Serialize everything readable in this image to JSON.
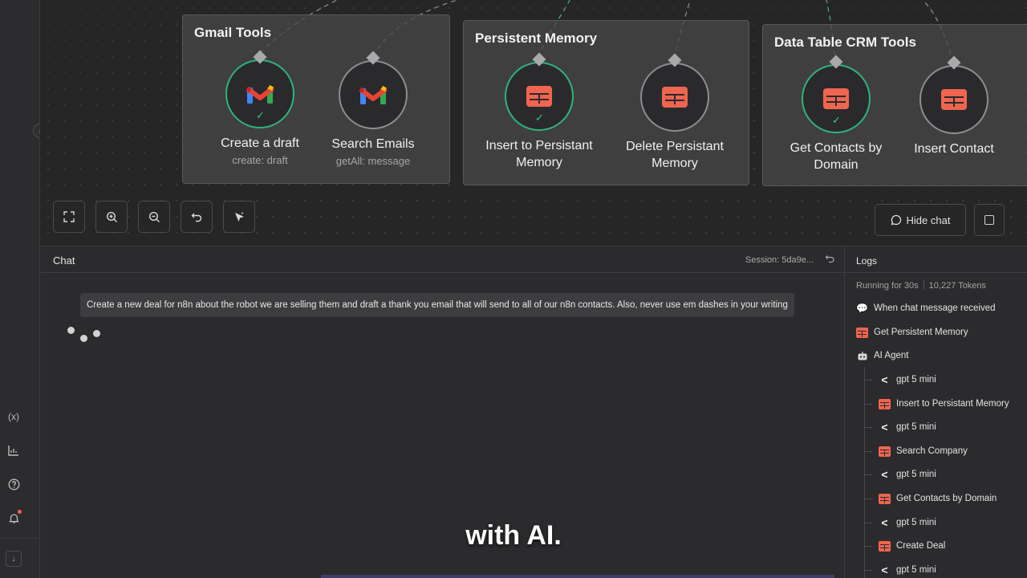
{
  "canvas": {
    "groups": [
      {
        "title": "Gmail Tools",
        "nodes": [
          {
            "title": "Create a draft",
            "subtitle": "create: draft",
            "icon": "gmail-icon",
            "status": "success"
          },
          {
            "title": "Search Emails",
            "subtitle": "getAll: message",
            "icon": "gmail-icon",
            "status": "idle"
          }
        ]
      },
      {
        "title": "Persistent Memory",
        "nodes": [
          {
            "title": "Insert to Persistant Memory",
            "subtitle": "",
            "icon": "data-table-icon",
            "status": "success"
          },
          {
            "title": "Delete Persistant Memory",
            "subtitle": "",
            "icon": "data-table-icon",
            "status": "idle"
          }
        ]
      },
      {
        "title": "Data Table CRM Tools",
        "nodes": [
          {
            "title": "Get Contacts by Domain",
            "subtitle": "",
            "icon": "data-table-icon",
            "status": "success"
          },
          {
            "title": "Insert Contact",
            "subtitle": "",
            "icon": "data-table-icon",
            "status": "idle"
          }
        ]
      }
    ],
    "toolbar": [
      "fit-view-icon",
      "zoom-in-icon",
      "zoom-out-icon",
      "undo-icon",
      "tidy-up-icon"
    ],
    "hide_chat_label": "Hide chat"
  },
  "chat": {
    "title": "Chat",
    "session": "Session: 5da9e...",
    "user_message": "Create a new deal for n8n about the robot we are selling them and draft a thank you email that will send to all of our n8n contacts. Also, never use em dashes in your writing"
  },
  "logs": {
    "title": "Logs",
    "running": "Running for 30s",
    "tokens": "10,227 Tokens",
    "items": [
      {
        "label": "When chat message received",
        "icon": "chat-icon",
        "level": 0
      },
      {
        "label": "Get Persistent Memory",
        "icon": "data-table-icon",
        "level": 0
      },
      {
        "label": "AI Agent",
        "icon": "robot-icon",
        "level": 0
      },
      {
        "label": "gpt 5 mini",
        "icon": "openai-icon",
        "level": 1
      },
      {
        "label": "Insert to Persistant Memory",
        "icon": "data-table-icon",
        "level": 1
      },
      {
        "label": "gpt 5 mini",
        "icon": "openai-icon",
        "level": 1
      },
      {
        "label": "Search Company",
        "icon": "data-table-icon",
        "level": 1
      },
      {
        "label": "gpt 5 mini",
        "icon": "openai-icon",
        "level": 1
      },
      {
        "label": "Get Contacts by Domain",
        "icon": "data-table-icon",
        "level": 1
      },
      {
        "label": "gpt 5 mini",
        "icon": "openai-icon",
        "level": 1
      },
      {
        "label": "Create Deal",
        "icon": "data-table-icon",
        "level": 1
      },
      {
        "label": "gpt 5 mini",
        "icon": "openai-icon",
        "level": 1
      }
    ]
  },
  "caption": "with AI.",
  "colors": {
    "accent_success": "#2fb37a",
    "data_table": "#f06550",
    "background": "#232323"
  }
}
